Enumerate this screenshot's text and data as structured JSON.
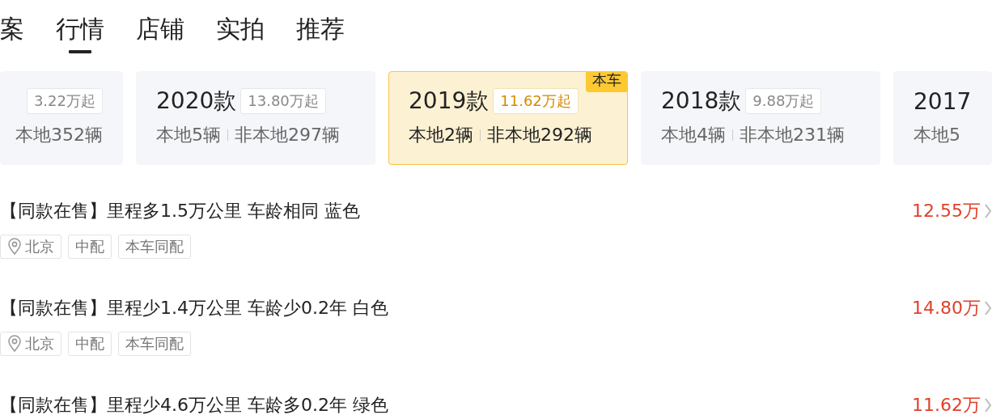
{
  "tabs": [
    {
      "label": "案",
      "selected": false
    },
    {
      "label": "行情",
      "selected": true
    },
    {
      "label": "店铺",
      "selected": false
    },
    {
      "label": "实拍",
      "selected": false
    },
    {
      "label": "推荐",
      "selected": false
    }
  ],
  "model_years": [
    {
      "price": "3.22万起",
      "non_local": "本地352辆",
      "selected": false
    },
    {
      "year": "2020款",
      "price": "13.80万起",
      "local": "本地5辆",
      "non_local": "非本地297辆",
      "selected": false
    },
    {
      "year": "2019款",
      "price": "11.62万起",
      "local": "本地2辆",
      "non_local": "非本地292辆",
      "selected": true,
      "badge": "本车"
    },
    {
      "year": "2018款",
      "price": "9.88万起",
      "local": "本地4辆",
      "non_local": "非本地231辆",
      "selected": false
    },
    {
      "year": "2017",
      "local": "本地5",
      "selected": false
    }
  ],
  "listings": [
    {
      "title": "【同款在售】里程多1.5万公里 车龄相同 蓝色",
      "price": "12.55万",
      "tags": [
        {
          "kind": "location",
          "text": "北京"
        },
        {
          "kind": "plain",
          "text": "中配"
        },
        {
          "kind": "plain",
          "text": "本车同配"
        }
      ]
    },
    {
      "title": "【同款在售】里程少1.4万公里 车龄少0.2年 白色",
      "price": "14.80万",
      "tags": [
        {
          "kind": "location",
          "text": "北京"
        },
        {
          "kind": "plain",
          "text": "中配"
        },
        {
          "kind": "plain",
          "text": "本车同配"
        }
      ]
    },
    {
      "title": "【同款在售】里程少4.6万公里 车龄多0.2年 绿色",
      "price": "11.62万"
    }
  ]
}
